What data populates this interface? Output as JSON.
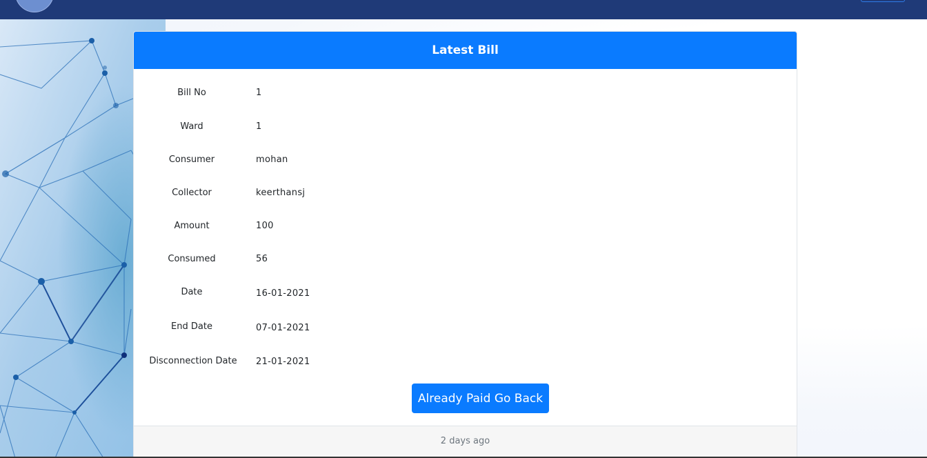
{
  "card": {
    "title": "Latest Bill",
    "details": [
      {
        "label": "Bill No",
        "value": "1"
      },
      {
        "label": "Ward",
        "value": "1"
      },
      {
        "label": "Consumer",
        "value": "mohan"
      },
      {
        "label": "Collector",
        "value": "keerthansj"
      },
      {
        "label": "Amount",
        "value": "100"
      },
      {
        "label": "Consumed",
        "value": "56"
      },
      {
        "label": "Date",
        "value": "16-01-2021"
      },
      {
        "label": "End Date",
        "value": "07-01-2021"
      },
      {
        "label": "Disconnection Date",
        "value": "21-01-2021"
      }
    ],
    "action_button_label": "Already Paid Go Back",
    "footer_text": "2 days ago"
  },
  "colors": {
    "navbar": "#1f3a78",
    "primary": "#0a7bff",
    "footer_bg": "#f6f6f6",
    "muted_text": "#6c757d"
  },
  "icons": {
    "navbar_logo": "logo-icon"
  }
}
